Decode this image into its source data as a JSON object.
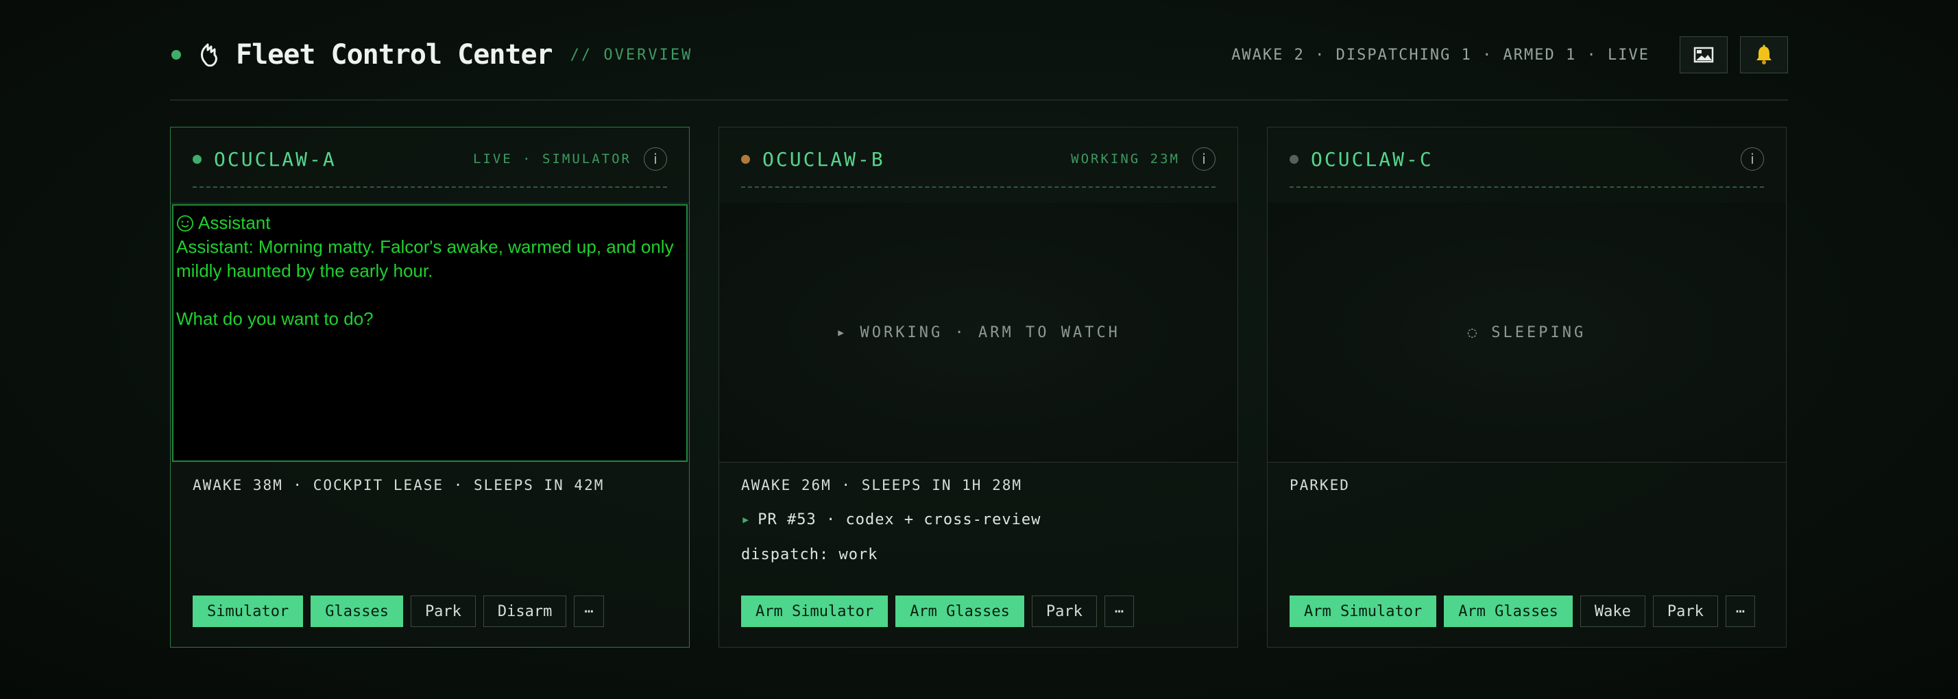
{
  "header": {
    "title": "Fleet Control Center",
    "subtitle": "// OVERVIEW",
    "status_summary": "AWAKE 2 · DISPATCHING 1 · ARMED 1 · LIVE",
    "buttons": [
      {
        "name": "gallery",
        "icon": "image-icon"
      },
      {
        "name": "notifications",
        "icon": "bell-icon"
      }
    ]
  },
  "colors": {
    "accent": "#4ed68c",
    "status_live": "#3fae6a",
    "status_working": "#b07a3a",
    "status_parked": "#5a5f5c",
    "terminal_text": "#1fd12e"
  },
  "cards": [
    {
      "name": "OCUCLAW-A",
      "meta": "LIVE · SIMULATOR",
      "status_color": "#3fae6a",
      "terminal": {
        "role_icon": "smiley-icon",
        "role": "Assistant",
        "message": "Assistant: Morning matty. Falcor's awake, warmed up, and only mildly haunted by the early hour.",
        "question": "What do you want to do?"
      },
      "status_line": "AWAKE 38M · COCKPIT LEASE · SLEEPS IN 42M",
      "actions": [
        {
          "label": "Simulator",
          "style": "primary"
        },
        {
          "label": "Glasses",
          "style": "primary"
        },
        {
          "label": "Park",
          "style": "secondary"
        },
        {
          "label": "Disarm",
          "style": "secondary"
        },
        {
          "label": "⋯",
          "style": "more"
        }
      ]
    },
    {
      "name": "OCUCLAW-B",
      "meta": "WORKING 23M",
      "status_color": "#b07a3a",
      "viewport_text": "▸ WORKING · ARM TO WATCH",
      "status_line": "AWAKE 26M · SLEEPS IN 1H 28M",
      "task_arrow": "▸",
      "task": "PR #53 · codex + cross-review",
      "dispatch": "dispatch: work",
      "actions": [
        {
          "label": "Arm Simulator",
          "style": "primary"
        },
        {
          "label": "Arm Glasses",
          "style": "primary"
        },
        {
          "label": "Park",
          "style": "secondary"
        },
        {
          "label": "⋯",
          "style": "more"
        }
      ]
    },
    {
      "name": "OCUCLAW-C",
      "meta": "",
      "status_color": "#5a5f5c",
      "viewport_text": "◌ SLEEPING",
      "status_line": "PARKED",
      "actions": [
        {
          "label": "Arm Simulator",
          "style": "primary"
        },
        {
          "label": "Arm Glasses",
          "style": "primary"
        },
        {
          "label": "Wake",
          "style": "secondary"
        },
        {
          "label": "Park",
          "style": "secondary"
        },
        {
          "label": "⋯",
          "style": "more"
        }
      ]
    }
  ]
}
